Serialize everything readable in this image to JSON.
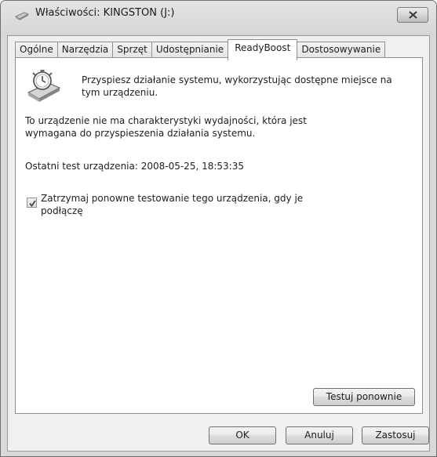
{
  "window": {
    "title": "Właściwości: KINGSTON (J:)"
  },
  "tabs": [
    {
      "label": "Ogólne",
      "active": false
    },
    {
      "label": "Narzędzia",
      "active": false
    },
    {
      "label": "Sprzęt",
      "active": false
    },
    {
      "label": "Udostępnianie",
      "active": false
    },
    {
      "label": "ReadyBoost",
      "active": true
    },
    {
      "label": "Dostosowywanie",
      "active": false
    }
  ],
  "readyboost": {
    "intro": "Przyspiesz działanie systemu, wykorzystując dostępne miejsce na tym urządzeniu.",
    "status": "To urządzenie nie ma charakterystyki wydajności, która jest wymagana do przyspieszenia działania systemu.",
    "last_test": "Ostatni test urządzenia: 2008-05-25, 18:53:35",
    "checkbox_label": "Zatrzymaj ponowne testowanie tego urządzenia, gdy je podłączę",
    "checkbox_checked": true,
    "retest_button": "Testuj ponownie"
  },
  "footer": {
    "ok": "OK",
    "cancel": "Anuluj",
    "apply": "Zastosuj"
  },
  "icons": {
    "title": "usb-drive-icon",
    "panel": "readyboost-stopwatch-icon",
    "close": "close-icon",
    "check": "checkmark-icon"
  }
}
